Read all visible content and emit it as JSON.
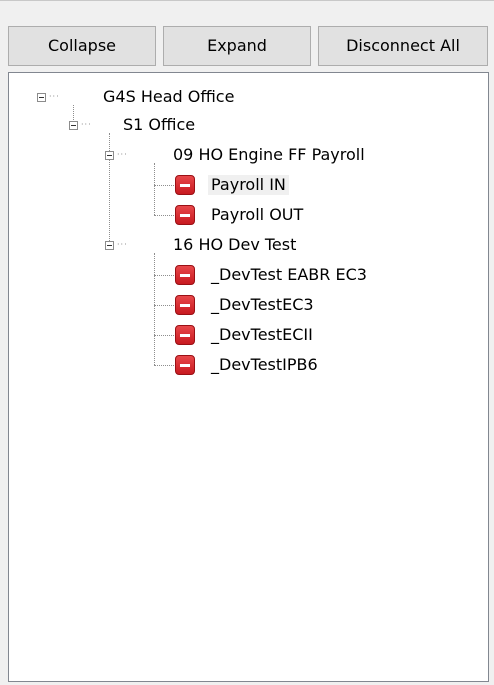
{
  "toolbar": {
    "collapse_label": "Collapse",
    "expand_label": "Expand",
    "disconnect_label": "Disconnect All"
  },
  "tree": {
    "root": "G4S Head Office",
    "office": "S1 Office",
    "groups": [
      {
        "label": "09 HO Engine FF Payroll",
        "items": [
          "Payroll IN",
          "Payroll OUT"
        ]
      },
      {
        "label": "16 HO Dev Test",
        "items": [
          "_DevTest EABR EC3",
          "_DevTestEC3",
          "_DevTestECII",
          "_DevTestIPB6"
        ]
      }
    ],
    "selected_item": "Payroll IN"
  },
  "colors": {
    "stop_icon": "#d32027",
    "button_face": "#e1e1e1",
    "tree_background": "#ffffff",
    "panel_background": "#f0f0f0"
  }
}
